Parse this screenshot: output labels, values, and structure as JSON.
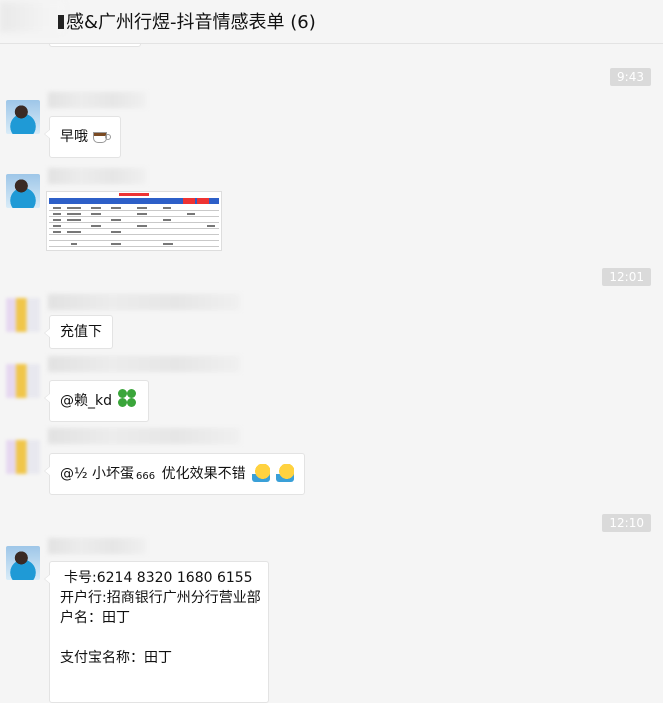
{
  "header": {
    "title": "感&广州行煜-抖音情感表单 (6)"
  },
  "timestamps": [
    "9:43",
    "12:01",
    "12:10"
  ],
  "messages": [
    {
      "text": "早哦",
      "emoji": "coffee-icon"
    },
    {
      "type": "image",
      "description_icon": "table-image"
    },
    {
      "text": "充值下"
    },
    {
      "text": "@赖_kd",
      "emoji": "clover-icon"
    },
    {
      "prefix": "@½ 小坏蛋",
      "small": "666",
      "suffix": " 优化效果不错",
      "emoji": "thumbs-up-icon"
    },
    {
      "lines": [
        "卡号:6214 8320 1680 6155",
        "开户行:招商银行广州分行营业部",
        "户名：田丁",
        "",
        "支付宝名称：田丁"
      ]
    }
  ]
}
